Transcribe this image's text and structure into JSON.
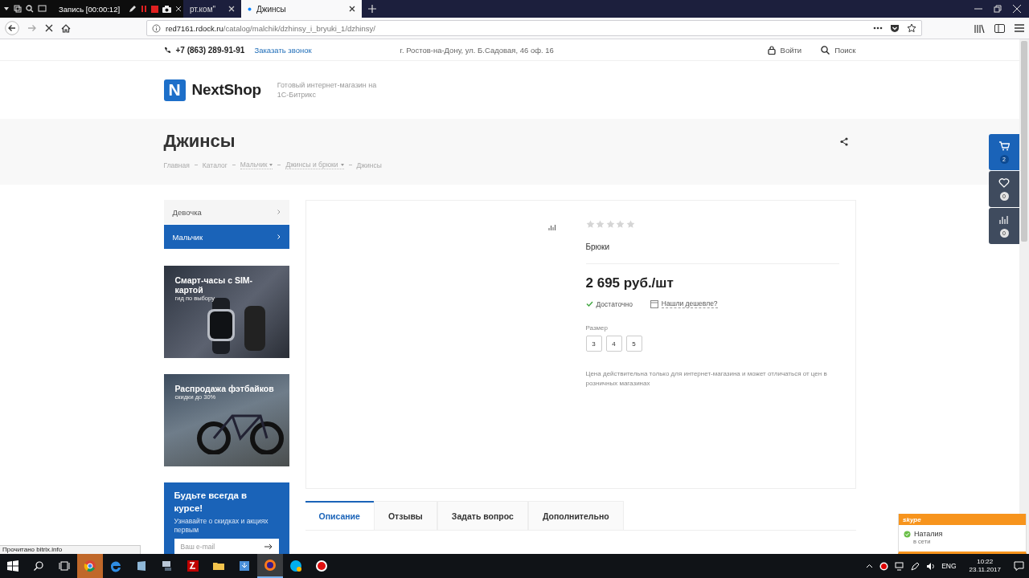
{
  "recorder": {
    "title": "Запись [00:00:12]"
  },
  "browser": {
    "tabs": [
      {
        "title": "рт.ком\"",
        "selected": false
      },
      {
        "title": "Джинсы",
        "selected": true
      }
    ],
    "url": {
      "host": "red7161.rdock.ru",
      "path": "/catalog/malchik/dzhinsy_i_bryuki_1/dzhinsy/"
    }
  },
  "topbar": {
    "phone": "+7 (863) 289-91-91",
    "callback": "Заказать звонок",
    "address": "г. Ростов-на-Дону, ул. Б.Садовая, 46 оф. 16",
    "login": "Войти",
    "search": "Поиск"
  },
  "logo": {
    "mark": "N",
    "name": "NextShop",
    "tagline": "Готовый интернет-магазин на 1С-Битрикс"
  },
  "page_title": "Джинсы",
  "breadcrumbs": [
    {
      "label": "Главная",
      "dropdown": false
    },
    {
      "label": "Каталог",
      "dropdown": false
    },
    {
      "label": "Мальчик",
      "dropdown": true
    },
    {
      "label": "Джинсы и брюки",
      "dropdown": true
    },
    {
      "label": "Джинсы",
      "dropdown": false
    }
  ],
  "sidebar": {
    "items": [
      {
        "label": "Девочка",
        "selected": false
      },
      {
        "label": "Мальчик",
        "selected": true
      }
    ]
  },
  "banners": [
    {
      "kind": "watch",
      "title": "Смарт-часы с SIM-картой",
      "subtitle": "гид по выбору"
    },
    {
      "kind": "bike",
      "title": "Распродажа фэтбайков",
      "subtitle": "скидки до 30%"
    }
  ],
  "subscribe": {
    "title": "Будьте всегда в курсе!",
    "text": "Узнавайте о скидках и акциях первым",
    "placeholder": "Ваш e-mail"
  },
  "product": {
    "stars": 0,
    "name": "Брюки",
    "price": "2 695 руб./шт",
    "stock": "Достаточно",
    "cheaper": "Нашли дешевле?",
    "size_label": "Размер",
    "sizes": [
      {
        "label": "3",
        "selected": false
      },
      {
        "label": "4",
        "selected": false
      },
      {
        "label": "5",
        "selected": false
      }
    ],
    "note": "Цена действительна только для интернет-магазина и может отличаться от цен в розничных магазинах"
  },
  "tabs": [
    {
      "label": "Описание",
      "selected": true
    },
    {
      "label": "Отзывы",
      "selected": false
    },
    {
      "label": "Задать вопрос",
      "selected": false
    },
    {
      "label": "Дополнительно",
      "selected": false
    }
  ],
  "side_panel": [
    {
      "kind": "cart",
      "count": "2",
      "highlighted": true
    },
    {
      "kind": "favorites",
      "count": "0",
      "highlighted": false
    },
    {
      "kind": "compare",
      "count": "0",
      "highlighted": false
    }
  ],
  "status_text": "Прочитано bitrix.info",
  "skype": {
    "brand": "skype",
    "contact": "Наталия",
    "status": "в сети"
  },
  "taskbar": {
    "apps": [
      {
        "kind": "chrome",
        "selected": false,
        "attention": true
      },
      {
        "kind": "edge",
        "selected": false,
        "attention": false
      },
      {
        "kind": "app",
        "selected": false,
        "attention": false
      },
      {
        "kind": "network",
        "selected": false,
        "attention": false
      },
      {
        "kind": "filezilla",
        "selected": false,
        "attention": false
      },
      {
        "kind": "folder",
        "selected": false,
        "attention": false
      },
      {
        "kind": "download",
        "selected": false,
        "attention": false
      },
      {
        "kind": "firefox",
        "selected": true,
        "attention": false
      },
      {
        "kind": "skype",
        "selected": false,
        "attention": false
      },
      {
        "kind": "record",
        "selected": false,
        "attention": false
      }
    ],
    "language": "ENG",
    "time": "10:22",
    "date": "23.11.2017"
  }
}
